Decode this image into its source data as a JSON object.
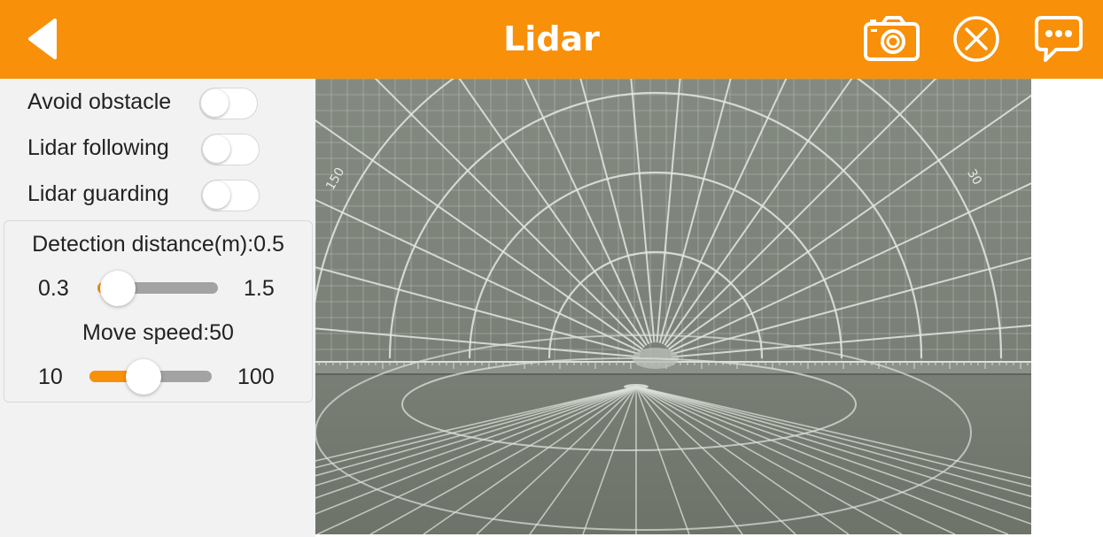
{
  "header": {
    "title": "Lidar",
    "background_color": "#f8900a",
    "back_icon": "back-arrow-icon",
    "actions": [
      {
        "name": "camera-button",
        "icon": "camera-icon"
      },
      {
        "name": "close-button",
        "icon": "close-circle-icon"
      },
      {
        "name": "chat-button",
        "icon": "chat-bubble-icon"
      }
    ]
  },
  "controls": {
    "toggles": [
      {
        "label": "Avoid obstacle",
        "on": false
      },
      {
        "label": "Lidar following",
        "on": false
      },
      {
        "label": "Lidar guarding",
        "on": false
      }
    ],
    "distance": {
      "label": "Detection distance(m):0.5",
      "min_label": "0.3",
      "max_label": "1.5",
      "min": 0.3,
      "max": 1.5,
      "value": 0.5
    },
    "speed": {
      "label": "Move speed:50",
      "min_label": "10",
      "max_label": "100",
      "min": 10,
      "max": 100,
      "value": 50
    }
  },
  "camera_view": {
    "scale_labels": {
      "left": "150",
      "right": "30"
    }
  }
}
